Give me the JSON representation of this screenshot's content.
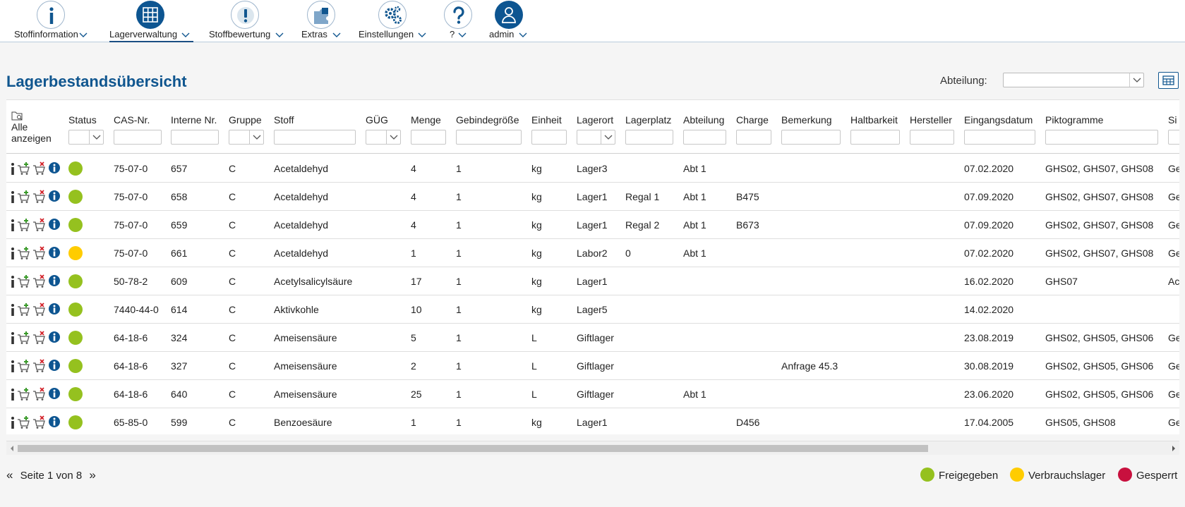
{
  "nav": {
    "items": [
      {
        "label": "Stoffinformation",
        "icon": "info-icon"
      },
      {
        "label": "Lagerverwaltung",
        "icon": "grid-icon"
      },
      {
        "label": "Stoffbewertung",
        "icon": "alert-icon"
      },
      {
        "label": "Extras",
        "icon": "puzzle-icon"
      },
      {
        "label": "Einstellungen",
        "icon": "gears-icon"
      },
      {
        "label": "?",
        "icon": "help-icon"
      },
      {
        "label": "admin",
        "icon": "user-icon"
      }
    ],
    "active": "Lagerverwaltung"
  },
  "page": {
    "title": "Lagerbestandsübersicht",
    "abteilung_label": "Abteilung:",
    "abteilung_value": ""
  },
  "table": {
    "show_all_label": "Alle anzeigen",
    "columns": [
      "Status",
      "CAS-Nr.",
      "Interne Nr.",
      "Gruppe",
      "Stoff",
      "GÜG",
      "Menge",
      "Gebindegröße",
      "Einheit",
      "Lagerort",
      "Lagerplatz",
      "Abteilung",
      "Charge",
      "Bemerkung",
      "Haltbarkeit",
      "Hersteller",
      "Eingangsdatum",
      "Piktogramme",
      "Si"
    ],
    "rows": [
      {
        "status": "freigegeben",
        "cas": "75-07-0",
        "intern": "657",
        "gruppe": "C",
        "stoff": "Acetaldehyd",
        "menge": "4",
        "gebinde": "1",
        "einheit": "kg",
        "lagerort": "Lager3",
        "lagerplatz": "",
        "abteilung": "Abt 1",
        "charge": "",
        "bemerkung": "",
        "datum": "07.02.2020",
        "pikto": "GHS02, GHS07, GHS08",
        "si": "Ge"
      },
      {
        "status": "freigegeben",
        "cas": "75-07-0",
        "intern": "658",
        "gruppe": "C",
        "stoff": "Acetaldehyd",
        "menge": "4",
        "gebinde": "1",
        "einheit": "kg",
        "lagerort": "Lager1",
        "lagerplatz": "Regal 1",
        "abteilung": "Abt 1",
        "charge": "B475",
        "bemerkung": "",
        "datum": "07.09.2020",
        "pikto": "GHS02, GHS07, GHS08",
        "si": "Ge"
      },
      {
        "status": "freigegeben",
        "cas": "75-07-0",
        "intern": "659",
        "gruppe": "C",
        "stoff": "Acetaldehyd",
        "menge": "4",
        "gebinde": "1",
        "einheit": "kg",
        "lagerort": "Lager1",
        "lagerplatz": "Regal 2",
        "abteilung": "Abt 1",
        "charge": "B673",
        "bemerkung": "",
        "datum": "07.09.2020",
        "pikto": "GHS02, GHS07, GHS08",
        "si": "Ge"
      },
      {
        "status": "verbrauchslager",
        "cas": "75-07-0",
        "intern": "661",
        "gruppe": "C",
        "stoff": "Acetaldehyd",
        "menge": "1",
        "gebinde": "1",
        "einheit": "kg",
        "lagerort": "Labor2",
        "lagerplatz": "0",
        "abteilung": "Abt 1",
        "charge": "",
        "bemerkung": "",
        "datum": "07.02.2020",
        "pikto": "GHS02, GHS07, GHS08",
        "si": "Ge"
      },
      {
        "status": "freigegeben",
        "cas": "50-78-2",
        "intern": "609",
        "gruppe": "C",
        "stoff": "Acetylsalicylsäure",
        "menge": "17",
        "gebinde": "1",
        "einheit": "kg",
        "lagerort": "Lager1",
        "lagerplatz": "",
        "abteilung": "",
        "charge": "",
        "bemerkung": "",
        "datum": "16.02.2020",
        "pikto": "GHS07",
        "si": "Ac"
      },
      {
        "status": "freigegeben",
        "cas": "7440-44-0",
        "intern": "614",
        "gruppe": "C",
        "stoff": "Aktivkohle",
        "menge": "10",
        "gebinde": "1",
        "einheit": "kg",
        "lagerort": "Lager5",
        "lagerplatz": "",
        "abteilung": "",
        "charge": "",
        "bemerkung": "",
        "datum": "14.02.2020",
        "pikto": "",
        "si": ""
      },
      {
        "status": "freigegeben",
        "cas": "64-18-6",
        "intern": "324",
        "gruppe": "C",
        "stoff": "Ameisensäure",
        "menge": "5",
        "gebinde": "1",
        "einheit": "L",
        "lagerort": "Giftlager",
        "lagerplatz": "",
        "abteilung": "",
        "charge": "",
        "bemerkung": "",
        "datum": "23.08.2019",
        "pikto": "GHS02, GHS05, GHS06",
        "si": "Ge"
      },
      {
        "status": "freigegeben",
        "cas": "64-18-6",
        "intern": "327",
        "gruppe": "C",
        "stoff": "Ameisensäure",
        "menge": "2",
        "gebinde": "1",
        "einheit": "L",
        "lagerort": "Giftlager",
        "lagerplatz": "",
        "abteilung": "",
        "charge": "",
        "bemerkung": "Anfrage 45.3",
        "datum": "30.08.2019",
        "pikto": "GHS02, GHS05, GHS06",
        "si": "Ge"
      },
      {
        "status": "freigegeben",
        "cas": "64-18-6",
        "intern": "640",
        "gruppe": "C",
        "stoff": "Ameisensäure",
        "menge": "25",
        "gebinde": "1",
        "einheit": "L",
        "lagerort": "Giftlager",
        "lagerplatz": "",
        "abteilung": "Abt 1",
        "charge": "",
        "bemerkung": "",
        "datum": "23.06.2020",
        "pikto": "GHS02, GHS05, GHS06",
        "si": "Ge"
      },
      {
        "status": "freigegeben",
        "cas": "65-85-0",
        "intern": "599",
        "gruppe": "C",
        "stoff": "Benzoesäure",
        "menge": "1",
        "gebinde": "1",
        "einheit": "kg",
        "lagerort": "Lager1",
        "lagerplatz": "",
        "abteilung": "",
        "charge": "D456",
        "bemerkung": "",
        "datum": "17.04.2005",
        "pikto": "GHS05, GHS08",
        "si": "Ge"
      }
    ]
  },
  "pager": {
    "text": "Seite 1 von 8",
    "prev": "«",
    "next": "»"
  },
  "legend": [
    {
      "label": "Freigegeben",
      "color": "#95c11f"
    },
    {
      "label": "Verbrauchslager",
      "color": "#ffcc00"
    },
    {
      "label": "Gesperrt",
      "color": "#c8103e"
    }
  ],
  "colors": {
    "accent": "#10568f",
    "green": "#95c11f",
    "yellow": "#ffcc00",
    "red": "#c8103e"
  }
}
